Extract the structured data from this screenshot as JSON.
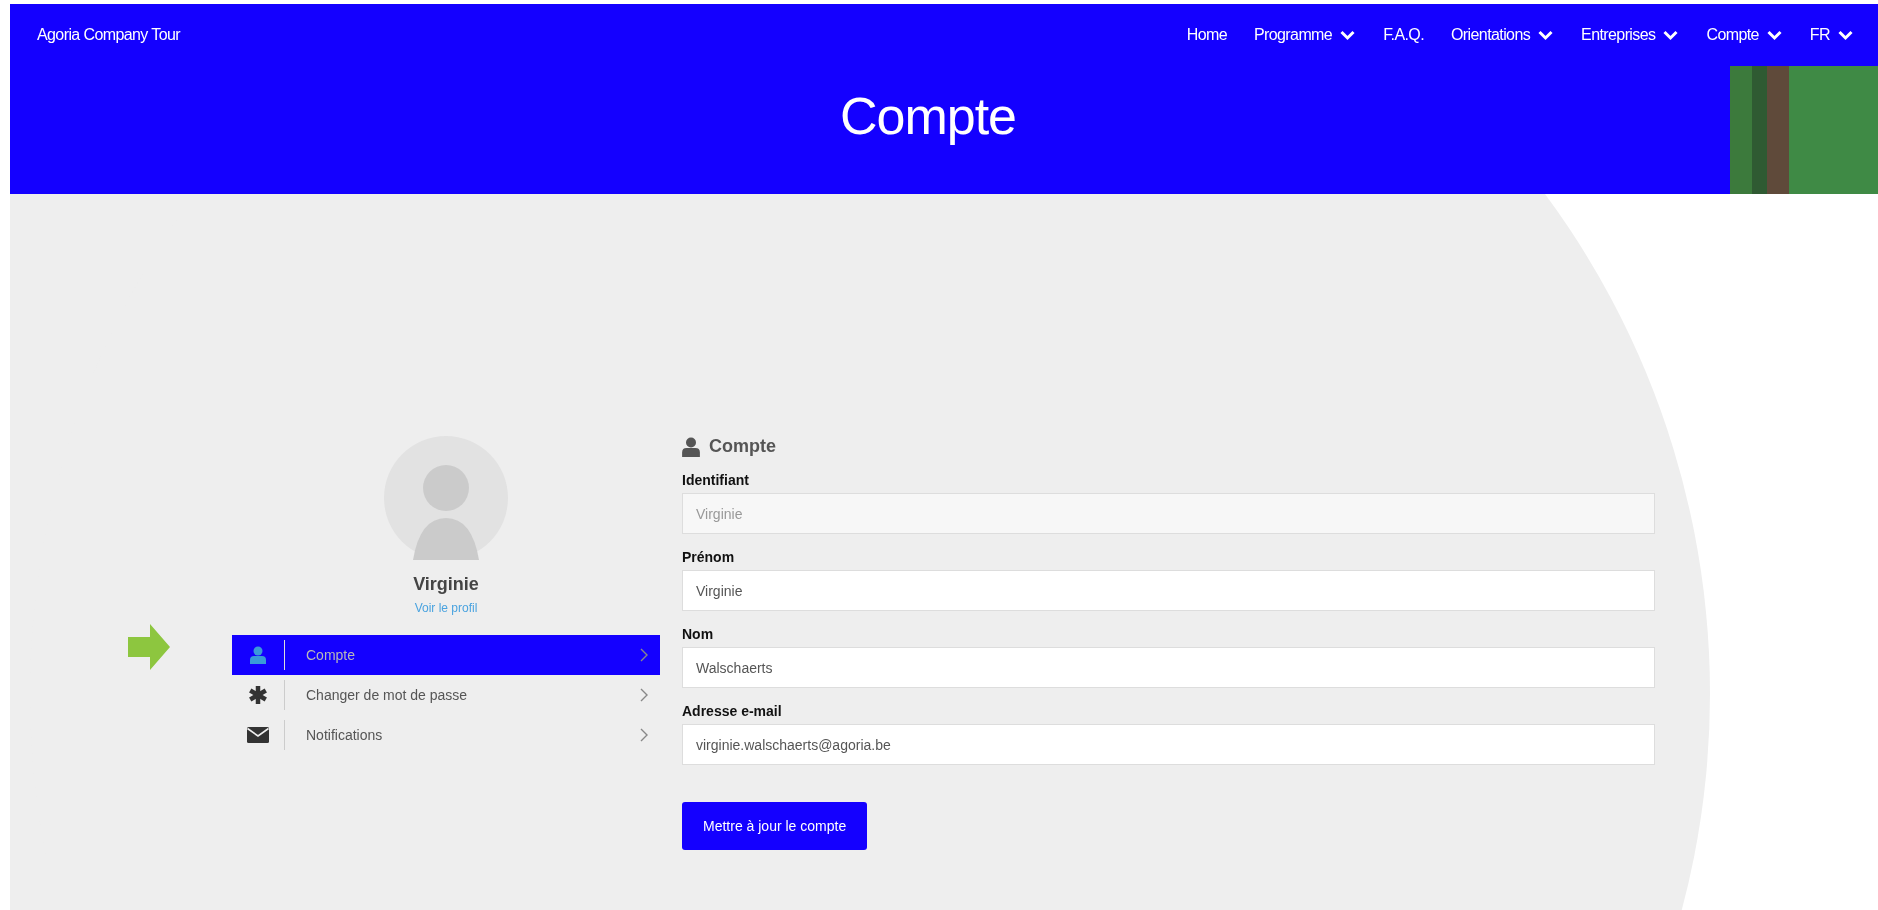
{
  "brand": "Agoria Company Tour",
  "nav": [
    {
      "label": "Home",
      "dropdown": false
    },
    {
      "label": "Programme",
      "dropdown": true
    },
    {
      "label": "F.A.Q.",
      "dropdown": false
    },
    {
      "label": "Orientations",
      "dropdown": true
    },
    {
      "label": "Entreprises",
      "dropdown": true
    },
    {
      "label": "Compte",
      "dropdown": true
    },
    {
      "label": "FR",
      "dropdown": true
    }
  ],
  "page_title": "Compte",
  "profile": {
    "name": "Virginie",
    "link": "Voir le profil"
  },
  "menu": [
    {
      "label": "Compte",
      "kind": "person",
      "selected": true
    },
    {
      "label": "Changer de mot de passe",
      "kind": "asterisk",
      "selected": false
    },
    {
      "label": "Notifications",
      "kind": "envelope",
      "selected": false
    }
  ],
  "form": {
    "heading": "Compte",
    "fields": [
      {
        "label": "Identifiant",
        "value": "Virginie",
        "disabled": true
      },
      {
        "label": "Prénom",
        "value": "Virginie",
        "disabled": false
      },
      {
        "label": "Nom",
        "value": "Walschaerts",
        "disabled": false
      },
      {
        "label": "Adresse e-mail",
        "value": "virginie.walschaerts@agoria.be",
        "disabled": false
      }
    ],
    "submit": "Mettre à jour le compte"
  }
}
